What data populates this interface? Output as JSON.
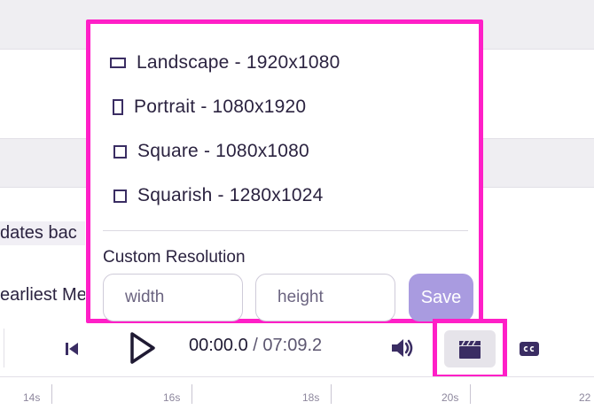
{
  "transcript": {
    "line1": "dates bac",
    "line2": "earliest Me"
  },
  "resolution_menu": {
    "options": [
      {
        "label": "Landscape - 1920x1080",
        "icon": "landscape-icon"
      },
      {
        "label": "Portrait - 1080x1920",
        "icon": "portrait-icon"
      },
      {
        "label": "Square - 1080x1080",
        "icon": "square-icon"
      },
      {
        "label": "Squarish - 1280x1024",
        "icon": "squarish-icon"
      }
    ],
    "custom_label": "Custom Resolution",
    "width_placeholder": "width",
    "height_placeholder": "height",
    "save_label": "Save"
  },
  "player": {
    "current_time": "00:00.0",
    "separator": " / ",
    "total_time": "07:09.2",
    "icons": [
      "skip-back-icon",
      "play-icon",
      "volume-icon",
      "clapperboard-icon",
      "closed-captions-icon"
    ]
  },
  "timeline": {
    "labels": [
      "14s",
      "16s",
      "18s",
      "20s",
      "22"
    ]
  },
  "colors": {
    "highlight": "#ff1fc7",
    "accent": "#a99be0",
    "ink": "#2b2340"
  }
}
